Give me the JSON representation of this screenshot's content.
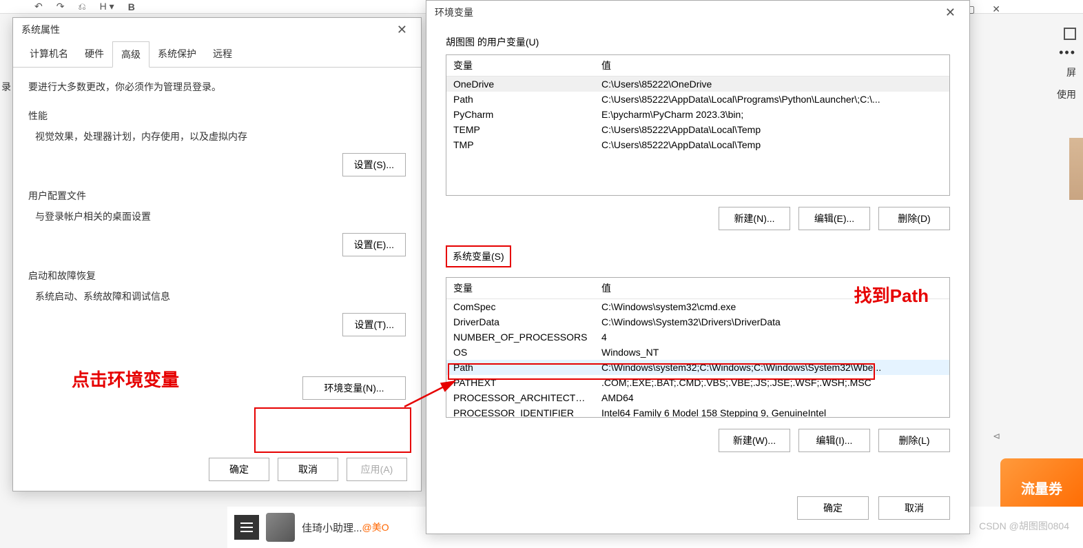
{
  "bg": {
    "left_text": "录",
    "right_expand": "屏",
    "right_use": "使用",
    "bottom_name": "佳琦小助理...",
    "bottom_at": "@美O",
    "right_snippet": "⊲",
    "banner": "流量券"
  },
  "watermark": "CSDN @胡图图0804",
  "sysprops": {
    "title": "系统属性",
    "tabs": [
      "计算机名",
      "硬件",
      "高级",
      "系统保护",
      "远程"
    ],
    "active_tab": "高级",
    "hint": "要进行大多数更改，你必须作为管理员登录。",
    "perf": {
      "legend": "性能",
      "desc": "视觉效果，处理器计划，内存使用，以及虚拟内存",
      "btn": "设置(S)..."
    },
    "profile": {
      "legend": "用户配置文件",
      "desc": "与登录帐户相关的桌面设置",
      "btn": "设置(E)..."
    },
    "startup": {
      "legend": "启动和故障恢复",
      "desc": "系统启动、系统故障和调试信息",
      "btn": "设置(T)..."
    },
    "envbtn": "环境变量(N)...",
    "ok": "确定",
    "cancel": "取消",
    "apply": "应用(A)",
    "annot": "点击环境变量"
  },
  "env": {
    "title": "环境变量",
    "user_label": "胡图图 的用户变量(U)",
    "col_var": "变量",
    "col_val": "值",
    "user_vars": [
      {
        "name": "OneDrive",
        "value": "C:\\Users\\85222\\OneDrive"
      },
      {
        "name": "Path",
        "value": "C:\\Users\\85222\\AppData\\Local\\Programs\\Python\\Launcher\\;C:\\..."
      },
      {
        "name": "PyCharm",
        "value": "E:\\pycharm\\PyCharm 2023.3\\bin;"
      },
      {
        "name": "TEMP",
        "value": "C:\\Users\\85222\\AppData\\Local\\Temp"
      },
      {
        "name": "TMP",
        "value": "C:\\Users\\85222\\AppData\\Local\\Temp"
      }
    ],
    "sys_label": "系统变量(S)",
    "sys_vars": [
      {
        "name": "ComSpec",
        "value": "C:\\Windows\\system32\\cmd.exe"
      },
      {
        "name": "DriverData",
        "value": "C:\\Windows\\System32\\Drivers\\DriverData"
      },
      {
        "name": "NUMBER_OF_PROCESSORS",
        "value": "4"
      },
      {
        "name": "OS",
        "value": "Windows_NT"
      },
      {
        "name": "Path",
        "value": "C:\\Windows\\system32;C:\\Windows;C:\\Windows\\System32\\Wbe..."
      },
      {
        "name": "PATHEXT",
        "value": ".COM;.EXE;.BAT;.CMD;.VBS;.VBE;.JS;.JSE;.WSF;.WSH;.MSC"
      },
      {
        "name": "PROCESSOR_ARCHITECTURE",
        "value": "AMD64"
      },
      {
        "name": "PROCESSOR_IDENTIFIER",
        "value": "Intel64 Family 6 Model 158 Stepping 9, GenuineIntel"
      }
    ],
    "new_u": "新建(N)...",
    "edit_u": "编辑(E)...",
    "del_u": "删除(D)",
    "new_s": "新建(W)...",
    "edit_s": "编辑(I)...",
    "del_s": "删除(L)",
    "ok": "确定",
    "cancel": "取消",
    "annot": "找到Path"
  }
}
